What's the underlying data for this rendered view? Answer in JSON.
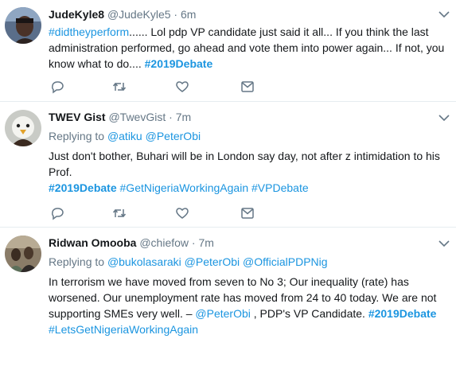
{
  "tweets": [
    {
      "name": "JudeKyle8",
      "handle": "@JudeKyle5",
      "dot": "·",
      "time": "6m",
      "text": {
        "l1_tag": "#didtheyperform",
        "l1_rest": "...... Lol pdp VP candidate just said it all... If you think the last",
        "l2": "administration performed, go ahead and vote them into power again... If not, you",
        "l3_pre": "know what to do.... ",
        "l3_tag": "#2019Debate"
      }
    },
    {
      "name": "TWEV Gist",
      "handle": "@TwevGist",
      "dot": "·",
      "time": "7m",
      "replying_label": "Replying to ",
      "replying_to": [
        "@atiku",
        "@PeterObi"
      ],
      "text": {
        "l1": "Just don't bother, Buhari will be in London say day, not after z intimidation to his",
        "l2": "Prof."
      },
      "tags": [
        "#2019Debate",
        "#GetNigeriaWorkingAgain",
        "#VPDebate"
      ]
    },
    {
      "name": "Ridwan Omooba",
      "handle": "@chiefow",
      "dot": "·",
      "time": "7m",
      "replying_label": "Replying to ",
      "replying_to": [
        "@bukolasaraki",
        "@PeterObi",
        "@OfficialPDPNig"
      ],
      "text": {
        "l1": "In terrorism we have moved from seven to No 3; Our inequality (rate) has",
        "l2": "worsened. Our unemployment rate has moved from 24 to 40 today. We are not",
        "l3_pre": "supporting SMEs very well. – ",
        "l3_mention": "@PeterObi",
        "l3_mid": " , PDP's VP Candidate. ",
        "l3_tag": "#2019Debate",
        "l4_tag": "#LetsGetNigeriaWorkingAgain"
      }
    }
  ],
  "action_icons": [
    "reply-icon",
    "retweet-icon",
    "like-icon",
    "message-icon"
  ],
  "colors": {
    "link": "#1b95e0",
    "muted": "#657786",
    "divider": "#e6ecf0"
  }
}
